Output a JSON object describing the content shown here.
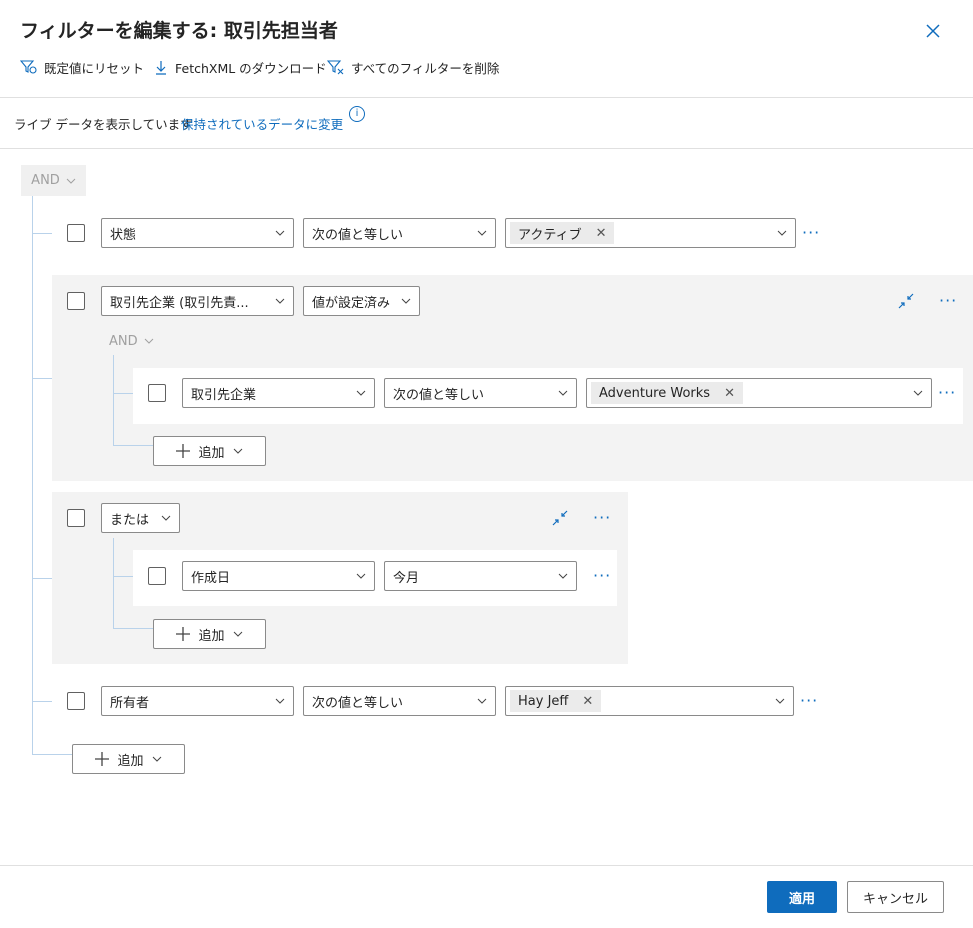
{
  "dialog": {
    "title": "フィルターを編集する: 取引先担当者",
    "toolbar": {
      "reset": "既定値にリセット",
      "download": "FetchXML のダウンロード",
      "clear": "すべてのフィルターを削除"
    },
    "live_text": "ライブ データを表示しています",
    "live_link": "保持されているデータに変更",
    "info": "i"
  },
  "root": {
    "operator": "AND"
  },
  "rows": {
    "status": {
      "field": "状態",
      "op": "次の値と等しい",
      "tag": "アクティブ"
    },
    "group1": {
      "field": "取引先企業 (取引先責...",
      "op": "値が設定済み",
      "inner_operator": "AND",
      "inner": {
        "field": "取引先企業",
        "op": "次の値と等しい",
        "tag": "Adventure Works"
      },
      "add": "追加"
    },
    "group2": {
      "operator": "または",
      "inner": {
        "field": "作成日",
        "op": "今月"
      },
      "add": "追加"
    },
    "owner": {
      "field": "所有者",
      "op": "次の値と等しい",
      "tag": "Hay Jeff"
    }
  },
  "add_root": "追加",
  "footer": {
    "apply": "適用",
    "cancel": "キャンセル"
  },
  "icons": {
    "tag_remove": "✕",
    "more": "···"
  },
  "colors": {
    "accent": "#0f6cbd",
    "panel": "#f3f3f3"
  }
}
